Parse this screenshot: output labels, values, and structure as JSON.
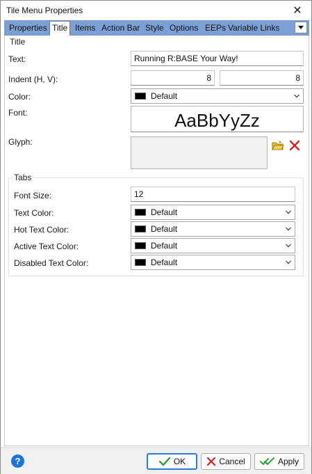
{
  "window": {
    "title": "Tile Menu Properties",
    "close_glyph": "✕"
  },
  "tabs": [
    {
      "label": "Properties",
      "active": false
    },
    {
      "label": "Title",
      "active": true
    },
    {
      "label": "Items",
      "active": false
    },
    {
      "label": "Action Bar",
      "active": false
    },
    {
      "label": "Style",
      "active": false
    },
    {
      "label": "Options",
      "active": false
    },
    {
      "label": "EEPs",
      "active": false
    },
    {
      "label": "Variable Links",
      "active": false
    }
  ],
  "title_group": {
    "label": "Title",
    "text_label": "Text:",
    "text_value": "Running R:BASE Your Way!",
    "indent_label": "Indent (H, V):",
    "indent_h": "8",
    "indent_v": "8",
    "color_label": "Color:",
    "color_value": "Default",
    "color_swatch": "#000000",
    "font_label": "Font:",
    "font_preview": "AaBbYyZz",
    "glyph_label": "Glyph:"
  },
  "tabs_group": {
    "label": "Tabs",
    "font_size_label": "Font Size:",
    "font_size_value": "12",
    "text_color_label": "Text Color:",
    "text_color_value": "Default",
    "hot_text_color_label": "Hot Text Color:",
    "hot_text_color_value": "Default",
    "active_text_color_label": "Active Text Color:",
    "active_text_color_value": "Default",
    "disabled_text_color_label": "Disabled Text Color:",
    "disabled_text_color_value": "Default"
  },
  "footer": {
    "help_glyph": "?",
    "ok_label": "OK",
    "cancel_label": "Cancel",
    "apply_label": "Apply"
  },
  "colors": {
    "tabstrip": "#7aa0d6",
    "help": "#1e73d9",
    "ok_check": "#2e9e3a",
    "cancel_x": "#d42020",
    "delete_x": "#d42020"
  }
}
